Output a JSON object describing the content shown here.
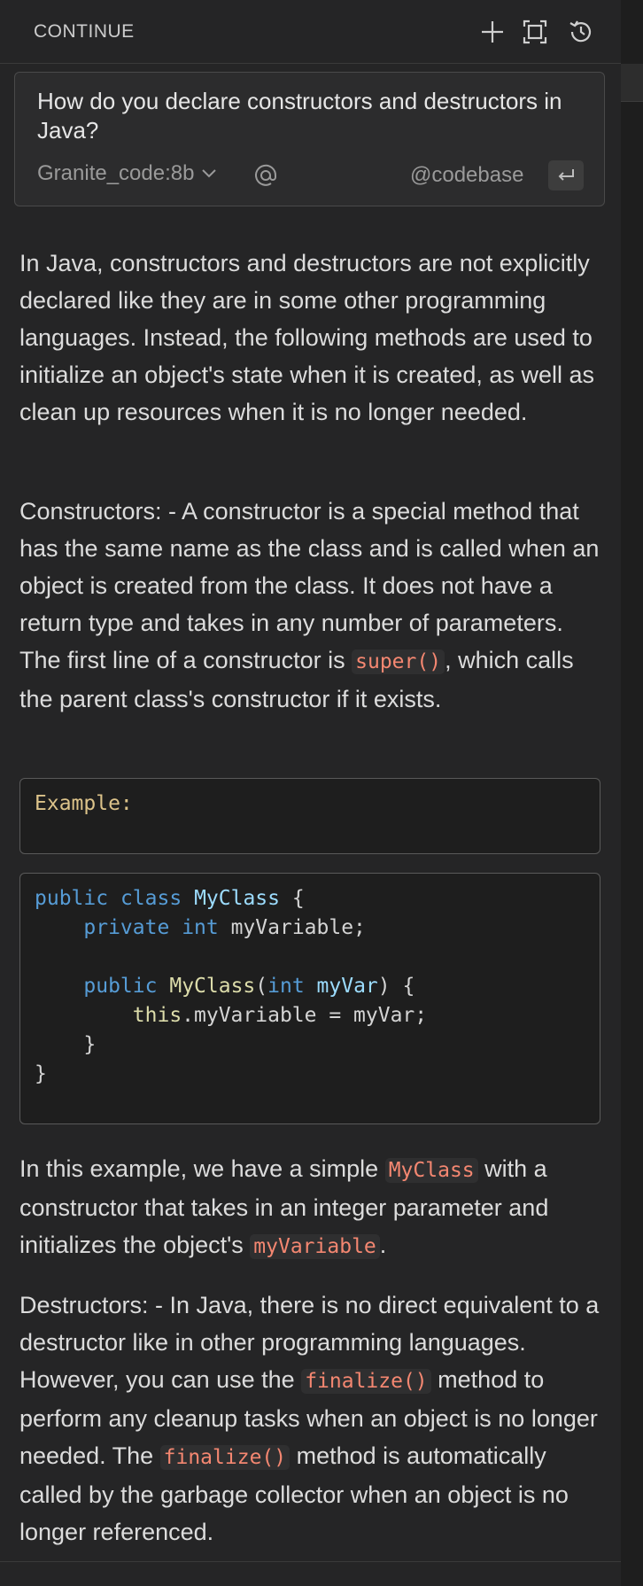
{
  "header": {
    "title": "CONTINUE",
    "icons": [
      "plus-icon",
      "fullscreen-icon",
      "history-icon"
    ]
  },
  "input": {
    "question": "How do you declare constructors and destructors in Java?",
    "model": "Granite_code:8b",
    "codebase_label": "@codebase"
  },
  "response": {
    "p1": "In Java, constructors and destructors are not explicitly declared like they are in some other programming languages. Instead, the following methods are used to initialize an object's state when it is created, as well as clean up resources when it is no longer needed.",
    "p2_before": "Constructors: - A constructor is a special method that has the same name as the class and is called when an object is created from the class. It does not have a return type and takes in any number of parameters. The first line of a constructor is ",
    "p2_code": "super()",
    "p2_after": ", which calls the parent class's constructor if it exists.",
    "example_label": "Example:",
    "p3_before": "In this example, we have a simple ",
    "p3_code1": "MyClass",
    "p3_mid": " with a constructor that takes in an integer parameter and initializes the object's ",
    "p3_code2": "myVariable",
    "p3_after": ".",
    "p4_before": "Destructors: - In Java, there is no direct equivalent to a destructor like in other programming languages. However, you can use the ",
    "p4_code1": "finalize()",
    "p4_mid": " method to perform any cleanup tasks when an object is no longer needed. The ",
    "p4_code2": "finalize()",
    "p4_after": " method is automatically called by the garbage collector when an object is no longer referenced."
  },
  "code": {
    "l1_kw1": "public",
    "l1_kw2": "class",
    "l1_cls": "MyClass",
    "l1_end": " {",
    "l2_kw1": "private",
    "l2_kw2": "int",
    "l2_rest": " myVariable;",
    "l3_kw": "public",
    "l3_fn": "MyClass",
    "l3_paren": "(",
    "l3_type": "int",
    "l3_param": "myVar",
    "l3_end": ") {",
    "l4_this": "this",
    "l4_rest": ".myVariable = myVar;",
    "l5": "}",
    "l6": "}"
  },
  "colors": {
    "background": "#252526",
    "inline_code": "#f48771",
    "keyword": "#569cd6"
  }
}
